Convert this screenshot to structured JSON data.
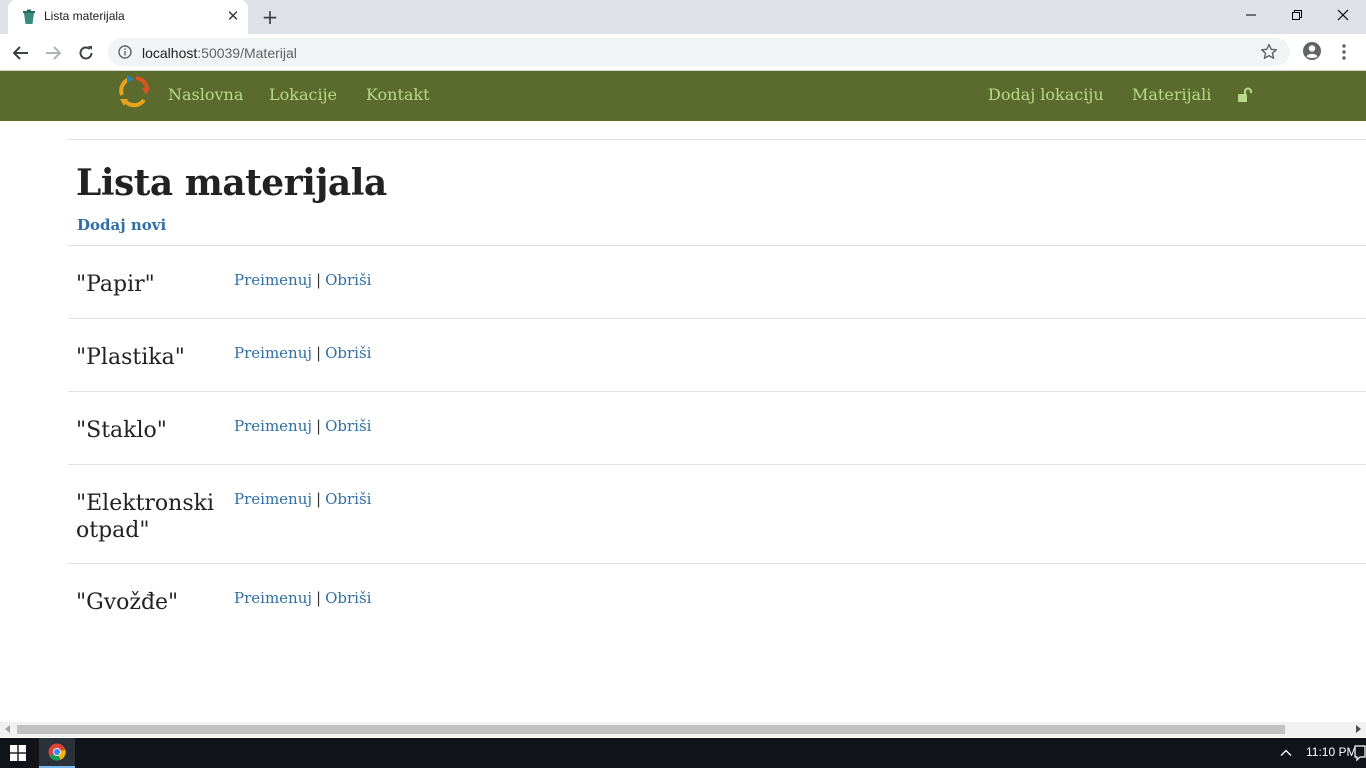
{
  "browser": {
    "tab_title": "Lista materijala",
    "url_host": "localhost",
    "url_rest": ":50039/Materijal"
  },
  "navbar": {
    "left_links": [
      "Naslovna",
      "Lokacije",
      "Kontakt"
    ],
    "right_links": [
      "Dodaj lokaciju",
      "Materijali"
    ],
    "color": "#5b6b2d",
    "link_color": "#b8d98a"
  },
  "page": {
    "title": "Lista materijala",
    "add_new": "Dodaj novi",
    "action_rename": "Preimenuj",
    "action_delete": "Obriši",
    "separator": "|",
    "materials": [
      "\"Papir\"",
      "\"Plastika\"",
      "\"Staklo\"",
      "\"Elektronski otpad\"",
      "\"Gvožđe\""
    ]
  },
  "taskbar": {
    "time": "11:10 PM"
  }
}
